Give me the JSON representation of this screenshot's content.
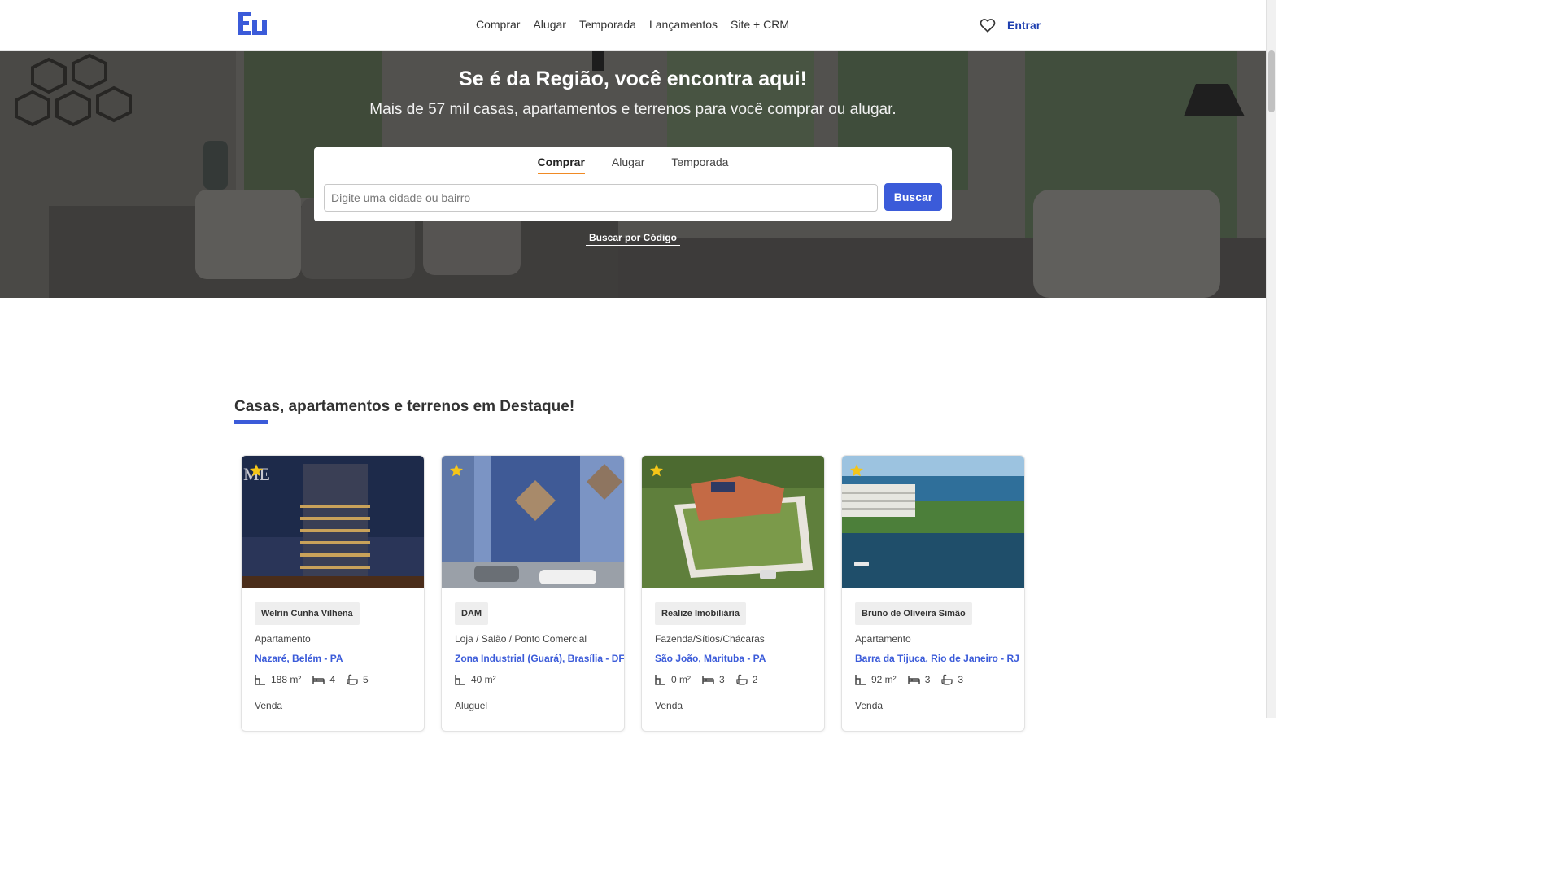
{
  "header": {
    "logo_text": "Eu",
    "nav": [
      "Comprar",
      "Alugar",
      "Temporada",
      "Lançamentos",
      "Site + CRM"
    ],
    "login": "Entrar",
    "favorites_icon": "heart-icon"
  },
  "hero": {
    "title": "Se é da Região, você encontra aqui!",
    "subtitle": "Mais de 57 mil casas, apartamentos e terrenos para você comprar ou alugar.",
    "tabs": [
      {
        "label": "Comprar",
        "active": true
      },
      {
        "label": "Alugar",
        "active": false
      },
      {
        "label": "Temporada",
        "active": false
      }
    ],
    "search_placeholder": "Digite uma cidade ou bairro",
    "search_button": "Buscar",
    "code_link": "Buscar por Código"
  },
  "featured": {
    "title": "Casas, apartamentos e terrenos em Destaque!",
    "cards": [
      {
        "agency": "Welrin Cunha Vilhena",
        "type": "Apartamento",
        "location": "Nazaré, Belém - PA",
        "area": "188 m²",
        "beds": "4",
        "baths": "5",
        "deal": "Venda"
      },
      {
        "agency": "DAM",
        "type": "Loja / Salão / Ponto Comercial",
        "location": "Zona Industrial (Guará), Brasília - DF",
        "area": "40 m²",
        "beds": null,
        "baths": null,
        "deal": "Aluguel"
      },
      {
        "agency": "Realize Imobiliária",
        "type": "Fazenda/Sítios/Chácaras",
        "location": "São João, Marituba - PA",
        "area": "0 m²",
        "beds": "3",
        "baths": "2",
        "deal": "Venda"
      },
      {
        "agency": "Bruno de Oliveira Simão",
        "type": "Apartamento",
        "location": "Barra da Tijuca, Rio de Janeiro - RJ",
        "area": "92 m²",
        "beds": "3",
        "baths": "3",
        "deal": "Venda"
      }
    ]
  },
  "colors": {
    "brand": "#3b5bd9",
    "active_tab": "#f08a24",
    "star": "#f5c518"
  }
}
